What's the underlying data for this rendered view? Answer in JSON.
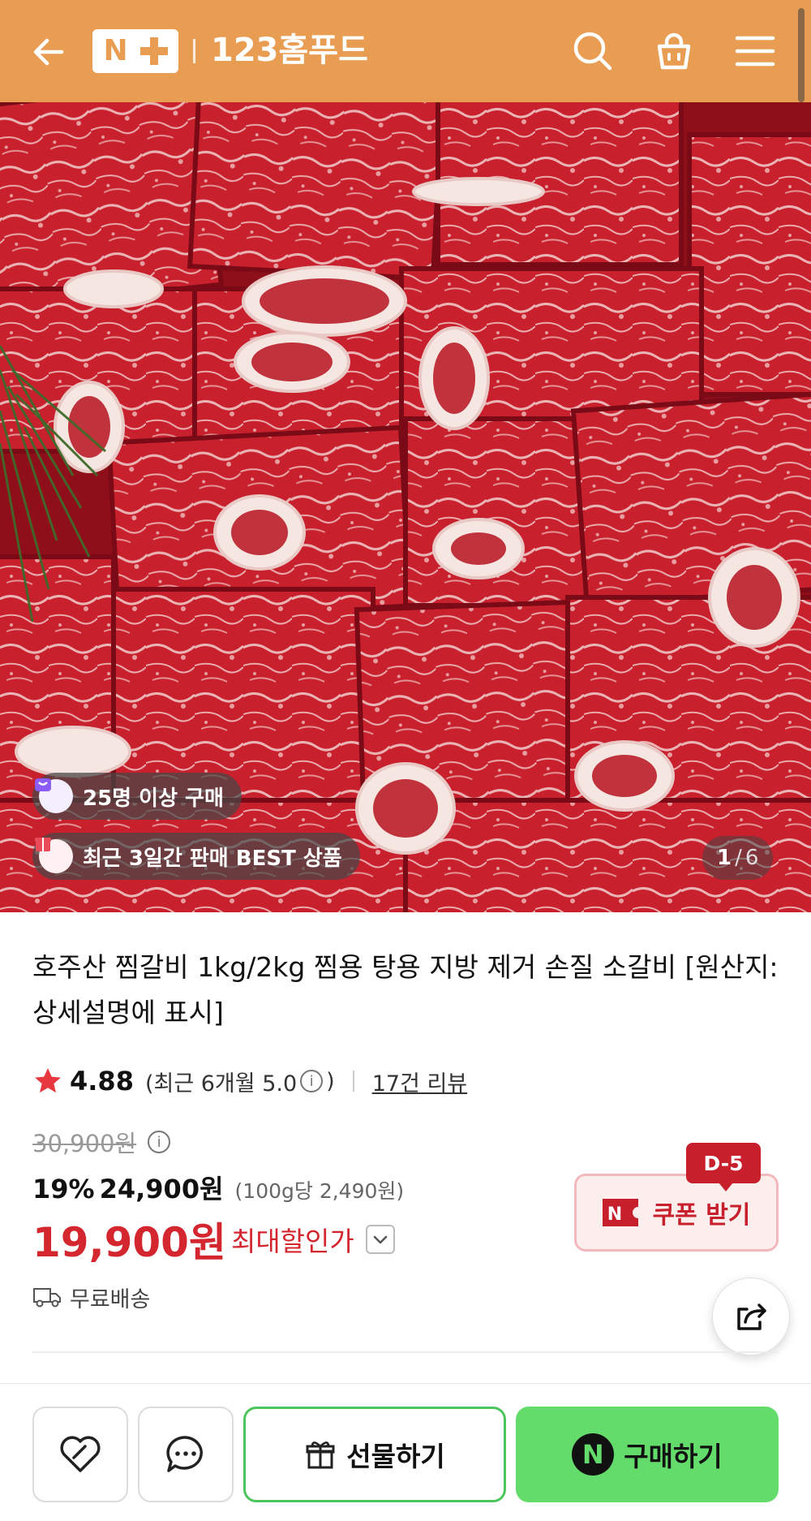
{
  "header": {
    "shop_name": "123홈푸드",
    "logo_letter": "N",
    "background": "#e99d53",
    "icons": [
      "back-arrow-icon",
      "search-icon",
      "shopping-bag-icon",
      "hamburger-menu-icon"
    ]
  },
  "hero": {
    "badges": [
      {
        "icon": "purchase-bag-icon",
        "text": "25명 이상 구매",
        "icon_color": "#8b5cf6"
      },
      {
        "icon": "gift-box-icon",
        "text": "최근 3일간 판매 BEST 상품",
        "icon_color": "#e94b5b"
      }
    ],
    "counter": {
      "current": "1",
      "separator": "/",
      "total": "6"
    }
  },
  "product": {
    "title": "호주산 찜갈비 1kg/2kg 찜용 탕용 지방 제거 손질 소갈비 [원산지:상세설명에 표시]",
    "rating": "4.88",
    "rating_recent_prefix": "(최근 6개월 5.0",
    "rating_recent_suffix": ")",
    "info_glyph": "i",
    "review_link": "17건 리뷰",
    "original_price": "30,900원",
    "discount_rate": "19%",
    "sale_price": "24,900원",
    "unit_price": "(100g당 2,490원)",
    "max_discount_price": "19,900원",
    "max_discount_label": "최대할인가",
    "shipping": "무료배송"
  },
  "coupon": {
    "label": "쿠폰 받기",
    "dday": "D-5",
    "accent": "#c7202c"
  },
  "bottom_bar": {
    "gift_label": "선물하기",
    "buy_label": "구매하기",
    "npay_letter": "N",
    "buy_color": "#64dc6b"
  }
}
